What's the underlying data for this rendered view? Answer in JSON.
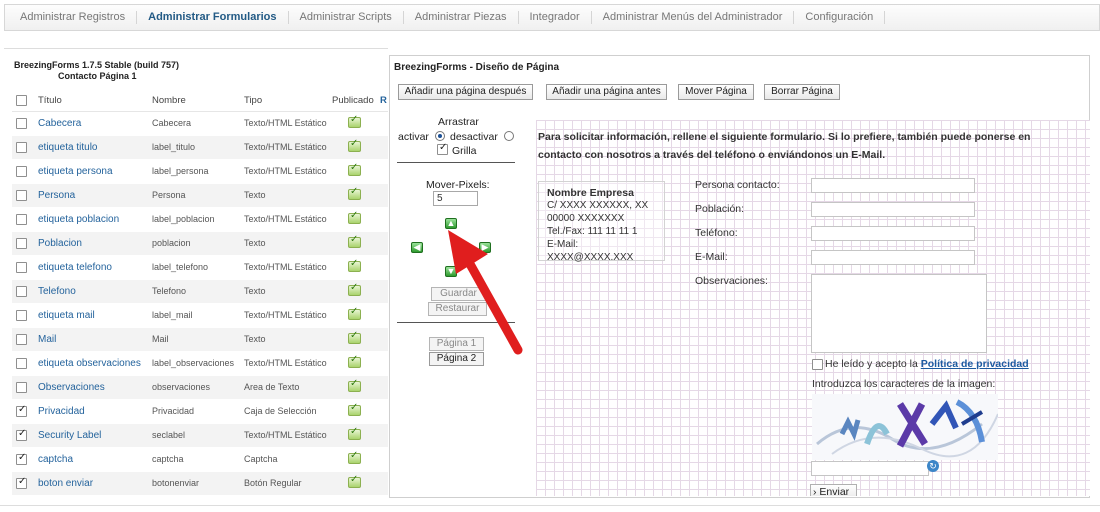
{
  "menu": [
    "Administrar Registros",
    "Administrar Formularios",
    "Administrar Scripts",
    "Administrar Piezas",
    "Integrador",
    "Administrar Menús del Administrador",
    "Configuración"
  ],
  "left": {
    "header1": "BreezingForms 1.7.5 Stable (build 757)",
    "header2": "Contacto Página 1",
    "columns": {
      "title": "Título",
      "name": "Nombre",
      "type": "Tipo",
      "published": "Publicado",
      "extra": "R"
    },
    "rows": [
      {
        "title": "Cabecera",
        "name": "Cabecera",
        "type": "Texto/HTML Estático",
        "checked": false
      },
      {
        "title": "etiqueta titulo",
        "name": "label_titulo",
        "type": "Texto/HTML Estático",
        "checked": false
      },
      {
        "title": "etiqueta persona",
        "name": "label_persona",
        "type": "Texto/HTML Estático",
        "checked": false
      },
      {
        "title": "Persona",
        "name": "Persona",
        "type": "Texto",
        "checked": false
      },
      {
        "title": "etiqueta poblacion",
        "name": "label_poblacion",
        "type": "Texto/HTML Estático",
        "checked": false
      },
      {
        "title": "Poblacion",
        "name": "poblacion",
        "type": "Texto",
        "checked": false
      },
      {
        "title": "etiqueta telefono",
        "name": "label_telefono",
        "type": "Texto/HTML Estático",
        "checked": false
      },
      {
        "title": "Telefono",
        "name": "Telefono",
        "type": "Texto",
        "checked": false
      },
      {
        "title": "etiqueta mail",
        "name": "label_mail",
        "type": "Texto/HTML Estático",
        "checked": false
      },
      {
        "title": "Mail",
        "name": "Mail",
        "type": "Texto",
        "checked": false
      },
      {
        "title": "etiqueta observaciones",
        "name": "label_observaciones",
        "type": "Texto/HTML Estático",
        "checked": false
      },
      {
        "title": "Observaciones",
        "name": "observaciones",
        "type": "Area de Texto",
        "checked": false
      },
      {
        "title": "Privacidad",
        "name": "Privacidad",
        "type": "Caja de Selección",
        "checked": true
      },
      {
        "title": "Security Label",
        "name": "seclabel",
        "type": "Texto/HTML Estático",
        "checked": true
      },
      {
        "title": "captcha",
        "name": "captcha",
        "type": "Captcha",
        "checked": true
      },
      {
        "title": "boton enviar",
        "name": "botonenviar",
        "type": "Botón Regular",
        "checked": true
      }
    ]
  },
  "designer": {
    "title": "BreezingForms - Diseño de Página",
    "buttons": {
      "add_after": "Añadir una página después",
      "add_before": "Añadir una página antes",
      "move": "Mover Página",
      "delete": "Borrar Página"
    },
    "drag_label": "Arrastrar",
    "activate_label": "activar",
    "deactivate_label": "desactivar",
    "grid_label": "Grilla",
    "move_pixels_label": "Mover-Pixels:",
    "move_pixels_value": "5",
    "save": "Guardar",
    "restore": "Restaurar",
    "page1": "Página 1",
    "page2": "Página 2"
  },
  "form": {
    "intro": "Para solicitar información, rellene el siguiente formulario. Si lo prefiere, también puede ponerse en contacto con nosotros  a través del teléfono o enviándonos un E-Mail.",
    "company_name": "Nombre Empresa",
    "company_lines": [
      "C/ XXXX XXXXXX, XX",
      "00000 XXXXXXX",
      "Tel./Fax: 111 11 11 1",
      "E-Mail: XXXX@XXXX.XXX"
    ],
    "labels": {
      "persona": "Persona contacto:",
      "poblacion": "Población:",
      "telefono": "Teléfono:",
      "email": "E-Mail:",
      "observaciones": "Observaciones:"
    },
    "privacy_text": "He leído y acepto la",
    "privacy_link": "Política de privacidad",
    "captcha_prompt": "Introduzca los caracteres de la imagen:",
    "submit": "› Enviar"
  }
}
